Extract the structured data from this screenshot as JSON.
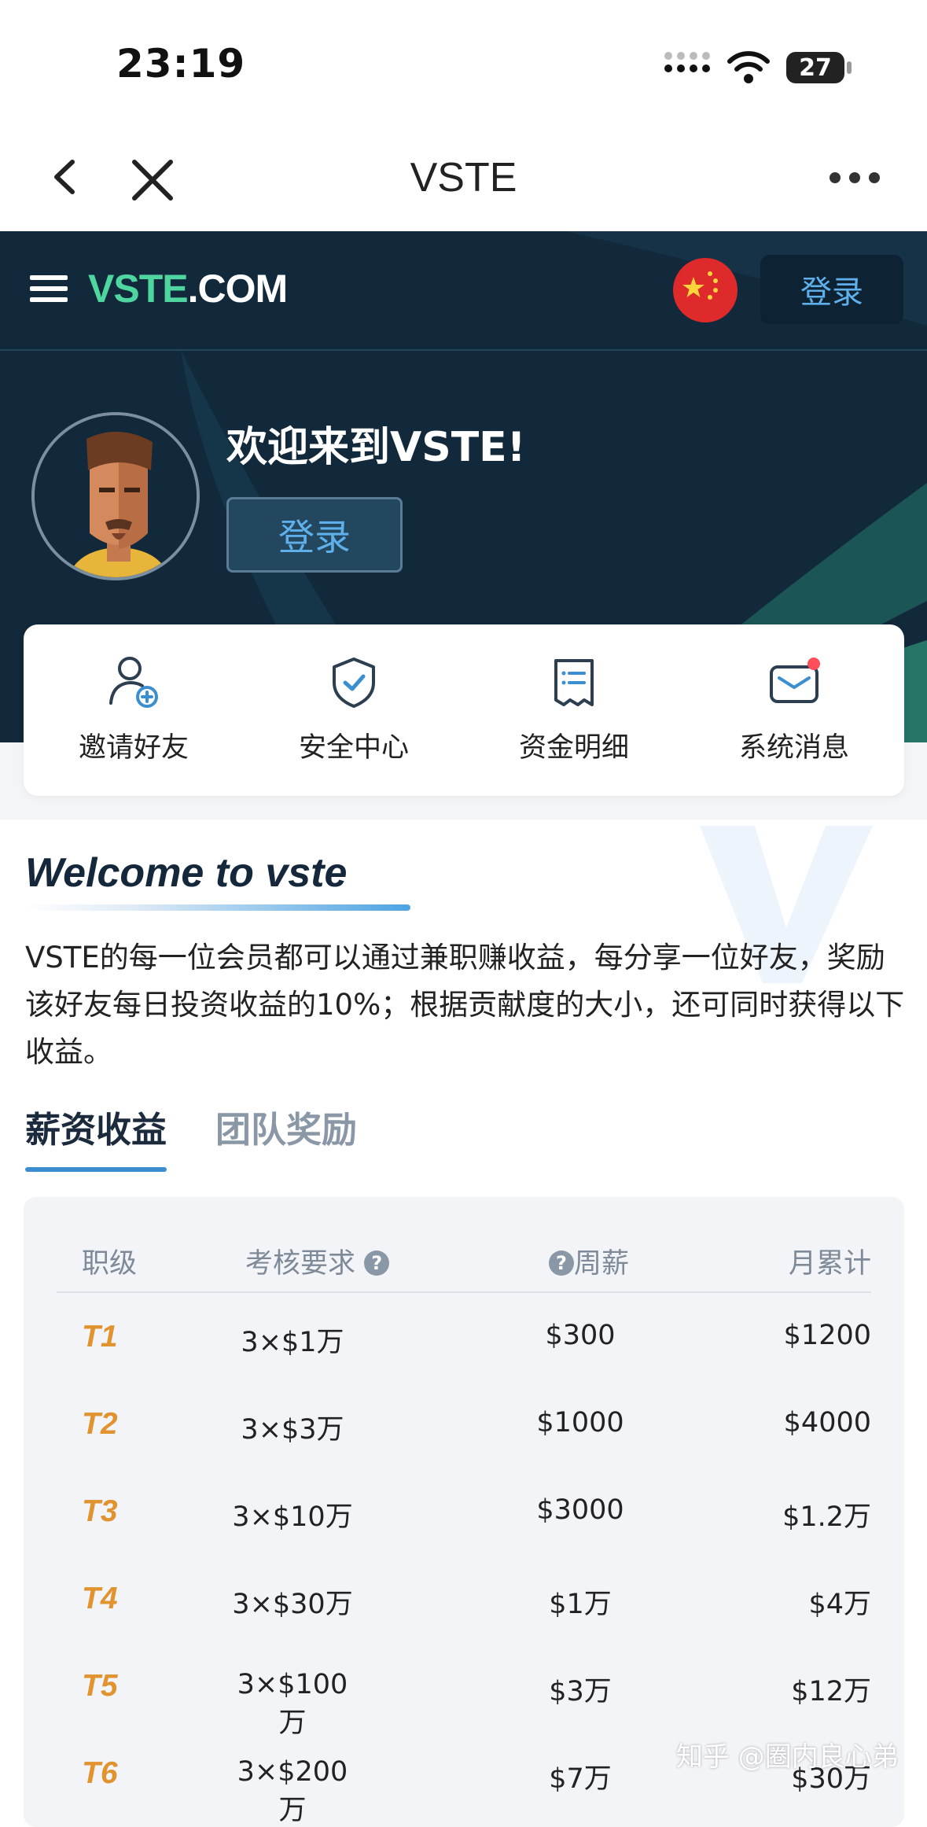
{
  "status_bar": {
    "time": "23:19",
    "battery": "27"
  },
  "nav": {
    "title": "VSTE"
  },
  "header": {
    "logo_part1": "VSTE",
    "logo_part2": ".COM",
    "login_top": "登录",
    "welcome": "欢迎来到VSTE!",
    "login_main": "登录"
  },
  "quick_actions": [
    {
      "label": "邀请好友",
      "icon": "invite-user-icon"
    },
    {
      "label": "安全中心",
      "icon": "shield-check-icon"
    },
    {
      "label": "资金明细",
      "icon": "receipt-icon"
    },
    {
      "label": "系统消息",
      "icon": "mail-icon"
    }
  ],
  "welcome_section": {
    "title": "Welcome to vste",
    "intro": "VSTE的每一位会员都可以通过兼职赚收益，每分享一位好友，奖励该好友每日投资收益的10%；根据贡献度的大小，还可同时获得以下收益。"
  },
  "tabs": [
    {
      "label": "薪资收益",
      "active": true
    },
    {
      "label": "团队奖励",
      "active": false
    }
  ],
  "table": {
    "headers": {
      "level": "职级",
      "requirement": "考核要求",
      "weekly": "周薪",
      "monthly": "月累计"
    },
    "help_mark": "?",
    "rows": [
      {
        "level": "T1",
        "requirement": "3×$1万",
        "weekly": "$300",
        "monthly": "$1200"
      },
      {
        "level": "T2",
        "requirement": "3×$3万",
        "weekly": "$1000",
        "monthly": "$4000"
      },
      {
        "level": "T3",
        "requirement": "3×$10万",
        "weekly": "$3000",
        "monthly": "$1.2万"
      },
      {
        "level": "T4",
        "requirement": "3×$30万",
        "weekly": "$1万",
        "monthly": "$4万"
      },
      {
        "level": "T5",
        "requirement": "3×$100万",
        "weekly": "$3万",
        "monthly": "$12万"
      },
      {
        "level": "T6",
        "requirement": "3×$200万",
        "weekly": "$7万",
        "monthly": "$30万"
      }
    ]
  },
  "watermark": "知乎 @圈内良心弟",
  "colors": {
    "header_bg": "#12293b",
    "accent_blue": "#3b8fd1",
    "level_orange": "#e0932e",
    "logo_green": "#4fd6a0"
  }
}
